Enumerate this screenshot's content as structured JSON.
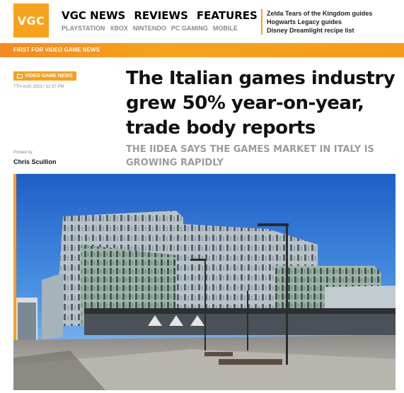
{
  "site": {
    "logo_text": "VGC"
  },
  "main_nav": [
    "VGC NEWS",
    "REVIEWS",
    "FEATURES"
  ],
  "sub_nav": [
    "PLAYSTATION",
    "XBOX",
    "NINTENDO",
    "PC GAMING",
    "MOBILE"
  ],
  "guides": [
    "Zelda Tears of the Kingdom guides",
    "Hogwarts Legacy guides",
    "Disney Dreamlight recipe list"
  ],
  "tagline": "FIRST FOR VIDEO GAME NEWS",
  "article": {
    "category": "VIDEO GAME NEWS",
    "date": "7TH AUG 2023 / 12:37 PM",
    "posted_by_label": "Posted by",
    "author": "Chris Scullion",
    "headline": "The Italian games industry grew 50% year-on-year, trade body reports",
    "subtitle": "THE IIDEA SAYS THE GAMES MARKET IN ITALY IS GROWING RAPIDLY"
  },
  "colors": {
    "accent": "#f7a21b",
    "accent_dark": "#f58a1f",
    "subtitle_gray": "#9c9c9c"
  },
  "icons": {
    "category_icon": "folder-icon"
  }
}
